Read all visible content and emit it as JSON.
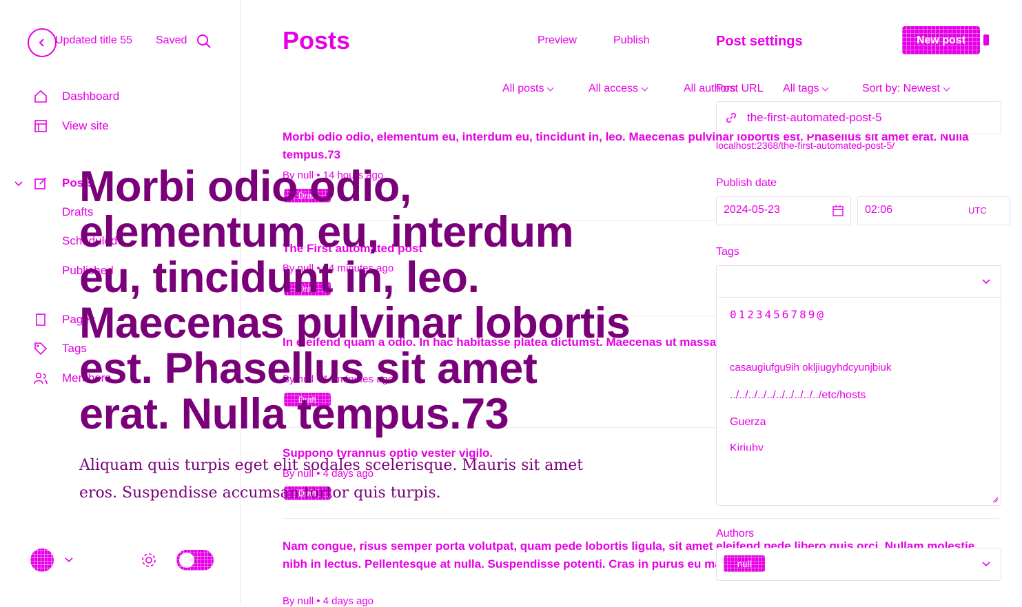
{
  "sidebar": {
    "site_title": "Updated title 55",
    "saved_status": "Saved",
    "back_label": "Posts",
    "nav": [
      {
        "label": "Dashboard",
        "icon": "home-icon"
      },
      {
        "label": "View site",
        "icon": "layout-icon"
      }
    ],
    "posts_label": "Posts",
    "sub_items": [
      "Drafts",
      "Scheduled",
      "Published"
    ],
    "nav2": [
      {
        "label": "Pages",
        "icon": "page-icon"
      },
      {
        "label": "Tags",
        "icon": "tag-icon"
      },
      {
        "label": "Members",
        "icon": "members-icon"
      }
    ]
  },
  "header": {
    "title": "Posts",
    "preview": "Preview",
    "publish": "Publish",
    "settings_title": "Post settings",
    "new_post": "New post"
  },
  "filters": {
    "all_posts": "All posts",
    "all_access": "All access",
    "all_authors": "All authors",
    "all_tags": "All tags",
    "sort": "Sort by: Newest"
  },
  "posts": [
    {
      "title": "Morbi odio odio, elementum eu, interdum eu, tincidunt in, leo. Maecenas pulvinar lobortis est. Phasellus sit amet erat. Nulla tempus.73",
      "meta": "By null • 14 hours ago",
      "badge": "Draft"
    },
    {
      "title": "The First automated post",
      "meta": "By null • 14 minutes ago",
      "badge": "Draft"
    },
    {
      "title": "In eleifend quam a odio. In hac habitasse platea dictumst. Maecenas ut massa quis augue luctus tincidunt.530",
      "meta": "By null • 14 minutes ago",
      "badge": "Draft"
    },
    {
      "title": "Suppono tyrannus optio vester vigilo.",
      "meta": "By null • 4 days ago",
      "badge": "Draft"
    },
    {
      "title": "Nam congue, risus semper porta volutpat, quam pede lobortis ligula, sit amet eleifend pede libero quis orci. Nullam molestie nibh in lectus. Pellentesque at nulla. Suspendisse potenti. Cras in purus eu magna vulputate luctus.",
      "meta": "By null • 4 days ago",
      "badge": "Draft"
    }
  ],
  "editor": {
    "title": "Morbi odio odio, elementum eu, interdum eu, tincidunt in, leo. Maecenas pulvinar lobortis est. Phasellus sit amet erat. Nulla tempus.73",
    "body": "Aliquam quis turpis eget elit sodales scelerisque. Mauris sit amet eros. Suspendisse accumsan tortor quis turpis."
  },
  "settings": {
    "post_url_label": "Post URL",
    "post_url_value": "the-first-automated-post-5",
    "post_url_hint": "localhost:2368/the-first-automated-post-5/",
    "publish_date_label": "Publish date",
    "date_value": "2024-05-23",
    "time_value": "02:06",
    "timezone": "UTC",
    "tags_label": "Tags",
    "tag_options": [
      "0123456789@",
      "casaugiufgu9ih okljiugyhdcyunjbiuk",
      "../../../../../../../../../../etc/hosts",
      "Guerza",
      "Kiriuby"
    ],
    "authors_label": "Authors",
    "author_chip": "null"
  },
  "footer": {
    "colors": {
      "accent": "#e600e6",
      "dark": "#7a007a"
    }
  }
}
